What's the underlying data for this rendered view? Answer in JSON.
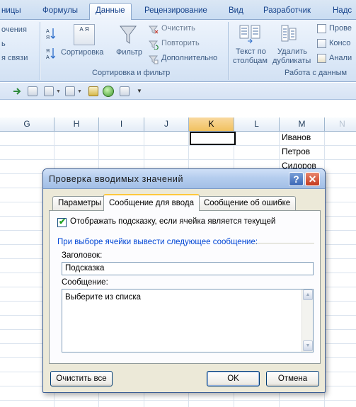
{
  "ribbon": {
    "tabs": [
      "ницы",
      "Формулы",
      "Данные",
      "Рецензирование",
      "Вид",
      "Разработчик",
      "Надс"
    ],
    "active_tab": "Данные",
    "left_partial": [
      "очения",
      "ь",
      "я связи"
    ],
    "sort_filter": {
      "sort_az": "А Я",
      "sort_label": "Сортировка",
      "filter_label": "Фильтр",
      "clear": "Очистить",
      "reapply": "Повторить",
      "advanced": "Дополнительно",
      "caption": "Сортировка и фильтр"
    },
    "data_tools": {
      "text_to_columns_1": "Текст по",
      "text_to_columns_2": "столбцам",
      "remove_dup_1": "Удалить",
      "remove_dup_2": "дубликаты",
      "validate": "Прове",
      "consolidate": "Консо",
      "analysis": "Анали",
      "caption": "Работа с данным"
    }
  },
  "sheet": {
    "columns": [
      "G",
      "H",
      "I",
      "J",
      "K",
      "L",
      "M",
      "N"
    ],
    "active_column": "K",
    "cells_m": [
      "Иванов",
      "Петров",
      "Сидоров"
    ]
  },
  "dialog": {
    "title": "Проверка вводимых значений",
    "help_glyph": "?",
    "close_glyph": "✕",
    "tabs": [
      "Параметры",
      "Сообщение для ввода",
      "Сообщение об ошибке"
    ],
    "active_tab": "Сообщение для ввода",
    "show_input_checkbox": "Отображать подсказку, если ячейка является текущей",
    "show_input_checked": true,
    "section_label": "При выборе ячейки вывести следующее сообщение:",
    "title_label": "Заголовок:",
    "title_value": "Подсказка",
    "message_label": "Сообщение:",
    "message_value": "Выберите из списка",
    "clear_all": "Очистить все",
    "ok": "OK",
    "cancel": "Отмена"
  }
}
